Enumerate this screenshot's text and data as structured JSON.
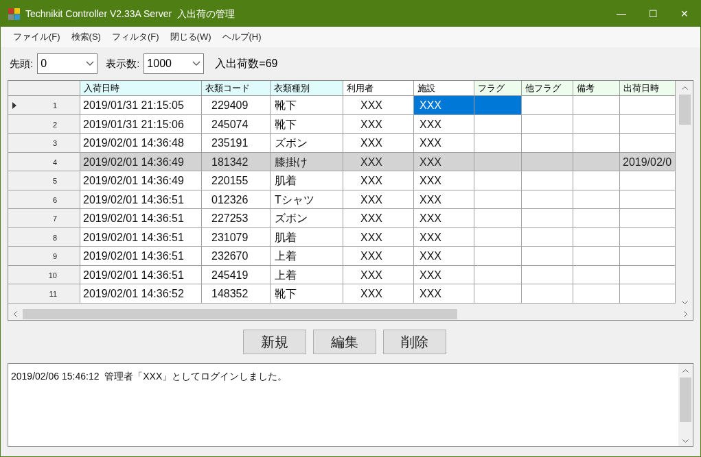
{
  "window": {
    "title": "Technikit Controller V2.33A Server  入出荷の管理",
    "controls": [
      "—",
      "☐",
      "✕"
    ]
  },
  "menu": [
    "ファイル(F)",
    "検索(S)",
    "フィルタ(F)",
    "閉じる(W)",
    "ヘルプ(H)"
  ],
  "toolbar": {
    "start_label": "先頭:",
    "start_value": "0",
    "count_label": "表示数:",
    "count_value": "1000",
    "total": "入出荷数=69"
  },
  "table": {
    "columns": [
      {
        "label": "入荷日時",
        "color": "#e0fbfc"
      },
      {
        "label": "衣類コード",
        "color": "#e0fbfc"
      },
      {
        "label": "衣類種別",
        "color": "#e0fbfc"
      },
      {
        "label": "利用者",
        "color": "#ffffff"
      },
      {
        "label": "施設",
        "color": "#ffffff"
      },
      {
        "label": "フラグ",
        "color": "#eefcee"
      },
      {
        "label": "他フラグ",
        "color": "#eefcee"
      },
      {
        "label": "備考",
        "color": "#eefcee"
      },
      {
        "label": "出荷日時",
        "color": "#eefcee"
      }
    ],
    "rows": [
      {
        "number": "1",
        "current": true,
        "selected": false,
        "cells": [
          {
            "text": "2019/01/31 21:15:05",
            "selected": false
          },
          {
            "text": "229409",
            "selected": false
          },
          {
            "text": "靴下",
            "selected": false
          },
          {
            "text": "XXX",
            "selected": false
          },
          {
            "text": "XXX",
            "selected": true
          },
          {
            "selected": true
          },
          {
            "selected": false
          },
          {
            "selected": false
          },
          {
            "selected": false
          }
        ]
      },
      {
        "number": "2",
        "current": false,
        "selected": false,
        "cells": [
          {
            "text": "2019/01/31 21:15:06",
            "selected": false
          },
          {
            "text": "245074",
            "selected": false
          },
          {
            "text": "靴下",
            "selected": false
          },
          {
            "text": "XXX",
            "selected": false
          },
          {
            "text": "XXX",
            "selected": false
          },
          {
            "selected": false
          },
          {
            "selected": false
          },
          {
            "selected": false
          },
          {
            "selected": false
          }
        ]
      },
      {
        "number": "3",
        "current": false,
        "selected": false,
        "cells": [
          {
            "text": "2019/02/01 14:36:48",
            "selected": false
          },
          {
            "text": "235191",
            "selected": false
          },
          {
            "text": "ズボン",
            "selected": false
          },
          {
            "text": "XXX",
            "selected": false
          },
          {
            "text": "XXX",
            "selected": false
          },
          {
            "selected": false
          },
          {
            "selected": false
          },
          {
            "selected": false
          },
          {
            "selected": false
          }
        ]
      },
      {
        "number": "4",
        "current": false,
        "selected": true,
        "cells": [
          {
            "text": "2019/02/01 14:36:49",
            "selected": false
          },
          {
            "text": "181342",
            "selected": false
          },
          {
            "text": "膝掛け",
            "selected": false
          },
          {
            "text": "XXX",
            "selected": false
          },
          {
            "text": "XXX",
            "selected": false
          },
          {
            "selected": false
          },
          {
            "selected": false
          },
          {
            "selected": false
          },
          {
            "text": "2019/02/0",
            "selected": false
          }
        ]
      },
      {
        "number": "5",
        "current": false,
        "selected": false,
        "cells": [
          {
            "text": "2019/02/01 14:36:49",
            "selected": false
          },
          {
            "text": "220155",
            "selected": false
          },
          {
            "text": "肌着",
            "selected": false
          },
          {
            "text": "XXX",
            "selected": false
          },
          {
            "text": "XXX",
            "selected": false
          },
          {
            "selected": false
          },
          {
            "selected": false
          },
          {
            "selected": false
          },
          {
            "selected": false
          }
        ]
      },
      {
        "number": "6",
        "current": false,
        "selected": false,
        "cells": [
          {
            "text": "2019/02/01 14:36:51",
            "selected": false
          },
          {
            "text": "012326",
            "selected": false
          },
          {
            "text": "Tシャツ",
            "selected": false
          },
          {
            "text": "XXX",
            "selected": false
          },
          {
            "text": "XXX",
            "selected": false
          },
          {
            "selected": false
          },
          {
            "selected": false
          },
          {
            "selected": false
          },
          {
            "selected": false
          }
        ]
      },
      {
        "number": "7",
        "current": false,
        "selected": false,
        "cells": [
          {
            "text": "2019/02/01 14:36:51",
            "selected": false
          },
          {
            "text": "227253",
            "selected": false
          },
          {
            "text": "ズボン",
            "selected": false
          },
          {
            "text": "XXX",
            "selected": false
          },
          {
            "text": "XXX",
            "selected": false
          },
          {
            "selected": false
          },
          {
            "selected": false
          },
          {
            "selected": false
          },
          {
            "selected": false
          }
        ]
      },
      {
        "number": "8",
        "current": false,
        "selected": false,
        "cells": [
          {
            "text": "2019/02/01 14:36:51",
            "selected": false
          },
          {
            "text": "231079",
            "selected": false
          },
          {
            "text": "肌着",
            "selected": false
          },
          {
            "text": "XXX",
            "selected": false
          },
          {
            "text": "XXX",
            "selected": false
          },
          {
            "selected": false
          },
          {
            "selected": false
          },
          {
            "selected": false
          },
          {
            "selected": false
          }
        ]
      },
      {
        "number": "9",
        "current": false,
        "selected": false,
        "cells": [
          {
            "text": "2019/02/01 14:36:51",
            "selected": false
          },
          {
            "text": "232670",
            "selected": false
          },
          {
            "text": "上着",
            "selected": false
          },
          {
            "text": "XXX",
            "selected": false
          },
          {
            "text": "XXX",
            "selected": false
          },
          {
            "selected": false
          },
          {
            "selected": false
          },
          {
            "selected": false
          },
          {
            "selected": false
          }
        ]
      },
      {
        "number": "10",
        "current": false,
        "selected": false,
        "cells": [
          {
            "text": "2019/02/01 14:36:51",
            "selected": false
          },
          {
            "text": "245419",
            "selected": false
          },
          {
            "text": "上着",
            "selected": false
          },
          {
            "text": "XXX",
            "selected": false
          },
          {
            "text": "XXX",
            "selected": false
          },
          {
            "selected": false
          },
          {
            "selected": false
          },
          {
            "selected": false
          },
          {
            "selected": false
          }
        ]
      },
      {
        "number": "11",
        "current": false,
        "selected": false,
        "cells": [
          {
            "text": "2019/02/01 14:36:52",
            "selected": false
          },
          {
            "text": "148352",
            "selected": false
          },
          {
            "text": "靴下",
            "selected": false
          },
          {
            "text": "XXX",
            "selected": false
          },
          {
            "text": "XXX",
            "selected": false
          },
          {
            "selected": false
          },
          {
            "selected": false
          },
          {
            "selected": false
          },
          {
            "selected": false
          }
        ]
      }
    ]
  },
  "buttons": [
    "新規",
    "編集",
    "削除"
  ],
  "log": [
    "2019/02/06 15:46:12  管理者「XXX」としてログインしました。"
  ]
}
